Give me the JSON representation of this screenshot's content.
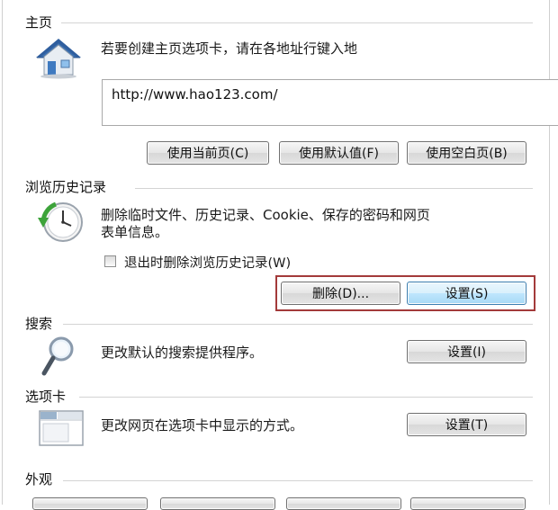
{
  "home": {
    "title": "主页",
    "description": "若要创建主页选项卡，请在各地址行键入地",
    "url": "http://www.hao123.com/",
    "buttons": [
      "使用当前页(C)",
      "使用默认值(F)",
      "使用空白页(B)"
    ]
  },
  "history": {
    "title": "浏览历史记录",
    "description_line1": "删除临时文件、历史记录、Cookie、保存的密码和网页",
    "description_line2": "表单信息。",
    "checkbox_label": "退出时删除浏览历史记录(W)",
    "checkbox_checked": false,
    "delete_button": "删除(D)...",
    "settings_button": "设置(S)"
  },
  "search": {
    "title": "搜索",
    "description": "更改默认的搜索提供程序。",
    "settings_button": "设置(I)"
  },
  "tabs": {
    "title": "选项卡",
    "description": "更改网页在选项卡中显示的方式。",
    "settings_button": "设置(T)"
  },
  "appearance": {
    "title": "外观"
  },
  "colors": {
    "highlight_border": "#a33a3a",
    "hot_button": "#bee6fd"
  },
  "icons": {
    "home": "house-icon",
    "history": "clock-arrow-icon",
    "search": "magnifier-icon",
    "tabs": "tabs-window-icon"
  }
}
